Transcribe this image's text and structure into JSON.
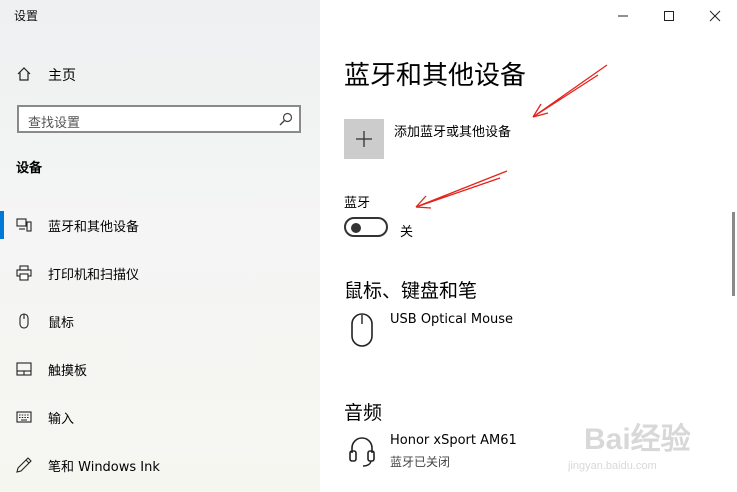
{
  "window": {
    "title": "设置",
    "controls": {
      "minimize": "minimize-icon",
      "maximize": "maximize-icon",
      "close": "close-icon"
    }
  },
  "sidebar": {
    "home_label": "主页",
    "search_placeholder": "查找设置",
    "section_title": "设备",
    "items": [
      {
        "label": "蓝牙和其他设备",
        "icon": "bluetooth-devices-icon",
        "active": true
      },
      {
        "label": "打印机和扫描仪",
        "icon": "printer-icon",
        "active": false
      },
      {
        "label": "鼠标",
        "icon": "mouse-icon",
        "active": false
      },
      {
        "label": "触摸板",
        "icon": "touchpad-icon",
        "active": false
      },
      {
        "label": "输入",
        "icon": "keyboard-icon",
        "active": false
      },
      {
        "label": "笔和 Windows Ink",
        "icon": "pen-icon",
        "active": false
      }
    ]
  },
  "main": {
    "title": "蓝牙和其他设备",
    "add_device_label": "添加蓝牙或其他设备",
    "bluetooth": {
      "label": "蓝牙",
      "state_label": "关"
    },
    "mouse_section": {
      "title": "鼠标、键盘和笔",
      "devices": [
        {
          "name": "USB Optical Mouse",
          "icon": "mouse-icon"
        }
      ]
    },
    "audio_section": {
      "title": "音频",
      "devices": [
        {
          "name": "Honor xSport AM61",
          "status": "蓝牙已关闭",
          "icon": "headset-icon"
        }
      ]
    }
  },
  "watermark": {
    "brand": "Bai经验",
    "url": "jingyan.baidu.com"
  },
  "colors": {
    "accent": "#0078d7",
    "annotation": "#e3231c",
    "sidebar_bg": "#f2f3f2"
  }
}
